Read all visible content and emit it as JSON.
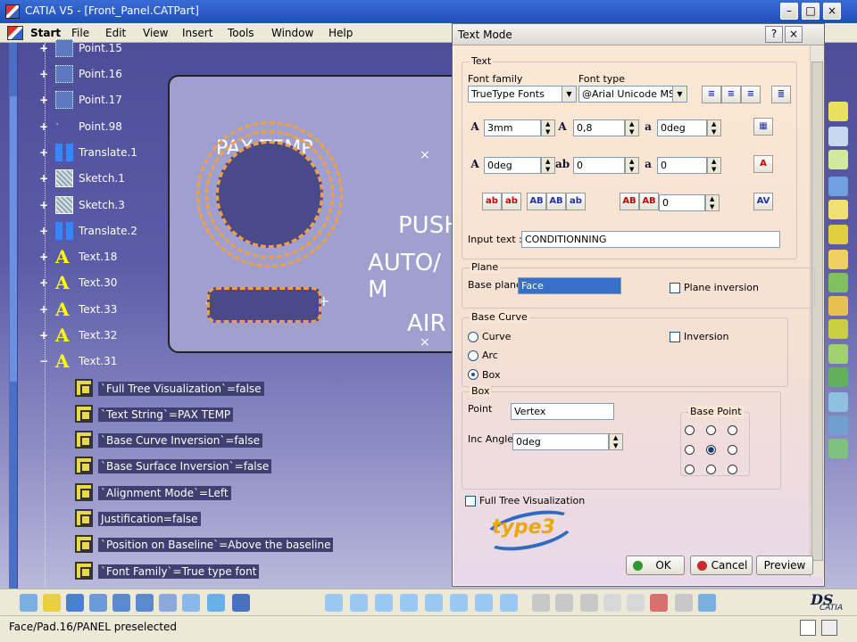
{
  "window": {
    "title": "CATIA V5 - [Front_Panel.CATPart]"
  },
  "menubar": {
    "items": [
      "Start",
      "File",
      "Edit",
      "View",
      "Insert",
      "Tools",
      "Window",
      "Help"
    ]
  },
  "tree": {
    "nodes": [
      {
        "label": "Point.15",
        "icon": "point-icon"
      },
      {
        "label": "Point.16",
        "icon": "point-icon"
      },
      {
        "label": "Point.17",
        "icon": "point-icon"
      },
      {
        "label": "Point.98",
        "icon": "point-icon"
      },
      {
        "label": "Translate.1",
        "icon": "translate-icon"
      },
      {
        "label": "Sketch.1",
        "icon": "sketch-icon"
      },
      {
        "label": "Sketch.3",
        "icon": "sketch-icon"
      },
      {
        "label": "Translate.2",
        "icon": "translate-icon"
      },
      {
        "label": "Text.18",
        "icon": "text-icon"
      },
      {
        "label": "Text.30",
        "icon": "text-icon"
      },
      {
        "label": "Text.33",
        "icon": "text-icon"
      },
      {
        "label": "Text.32",
        "icon": "text-icon"
      },
      {
        "label": "Text.31",
        "icon": "text-icon",
        "expanded": true
      }
    ],
    "params": [
      "`Full Tree Visualization`=false",
      "`Text String`=PAX TEMP",
      "`Base Curve Inversion`=false",
      "`Base Surface Inversion`=false",
      "`Alignment Mode`=Left",
      "Justification=false",
      "`Position on Baseline`=Above the baseline",
      "`Font Family`=True type font"
    ]
  },
  "part": {
    "label_pax_temp": "PAX TEMP",
    "label_push": "PUSH",
    "label_auto": "AUTO/ M",
    "label_air": "AIR",
    "minus": "-",
    "plus": "+",
    "cross": "×"
  },
  "statusbar": {
    "message": "Face/Pad.16/PANEL preselected"
  },
  "dialog": {
    "title": "Text Mode",
    "help_btn": "?",
    "close_btn": "×",
    "text_group": {
      "title": "Text",
      "font_family_label": "Font family",
      "font_type_label": "Font type",
      "font_family_value": "TrueType Fonts",
      "font_type_value": "@Arial Unicode MS",
      "char_height": "3mm",
      "char_ratio": "0,8",
      "slant_angle": "0deg",
      "rotation": "0deg",
      "spacing": "0",
      "offset": "0",
      "kerning": "0",
      "input_text_label": "Input text :",
      "input_text_value": "CONDITIONNING"
    },
    "plane_group": {
      "title": "Plane",
      "base_plane_label": "Base plane",
      "base_plane_value": "Face",
      "plane_inversion_label": "Plane inversion"
    },
    "base_curve_group": {
      "title": "Base Curve",
      "curve_label": "Curve",
      "arc_label": "Arc",
      "box_label": "Box",
      "inversion_label": "Inversion",
      "selected": "Box"
    },
    "box_group": {
      "title": "Box",
      "point_label": "Point",
      "point_value": "Vertex",
      "inc_angle_label": "Inc Angle",
      "inc_angle_value": "0deg",
      "base_point_label": "Base Point",
      "base_point_selected": 4
    },
    "full_tree_label": "Full Tree Visualization",
    "logo_text": "type3",
    "ok_label": "OK",
    "cancel_label": "Cancel",
    "preview_label": "Preview"
  },
  "colors": {
    "workspace": "#5b5ba8",
    "dialog_bg": "#fde8d4",
    "accent_orange": "#f0a040",
    "selection_blue": "#3a6fc8"
  }
}
